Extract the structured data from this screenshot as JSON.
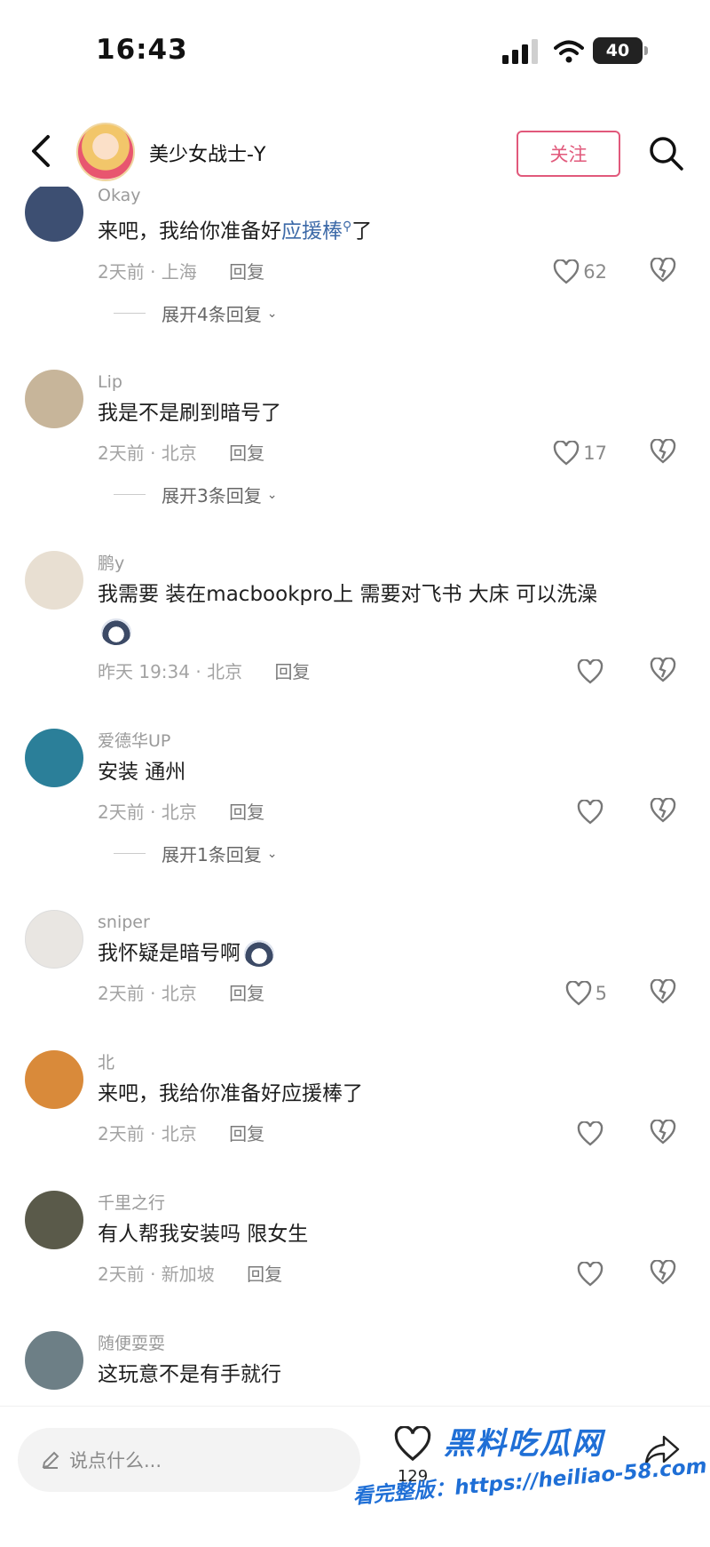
{
  "status": {
    "time": "16:43",
    "battery": "40"
  },
  "header": {
    "title": "美少女战士-Y",
    "follow_label": "关注"
  },
  "comments": [
    {
      "user": "Okay",
      "text_pre": "来吧，我给你准备好",
      "text_link": "应援棒",
      "text_post": "了",
      "time": "2天前 · 上海",
      "reply": "回复",
      "likes": "62",
      "expand": "展开4条回复",
      "avatar_color": "#3d4f72"
    },
    {
      "user": "Lip",
      "text": "我是不是刷到暗号了",
      "time": "2天前 · 北京",
      "reply": "回复",
      "likes": "17",
      "expand": "展开3条回复",
      "avatar_color": "#c7b59a"
    },
    {
      "user": "鹏y",
      "text": "我需要 装在macbookpro上 需要对飞书 大床 可以洗澡",
      "time": "昨天 19:34 · 北京",
      "reply": "回复",
      "likes": "",
      "avatar_color": "#e8dfd2"
    },
    {
      "user": "爱德华UP",
      "text": "安装 通州",
      "time": "2天前 · 北京",
      "reply": "回复",
      "likes": "",
      "expand": "展开1条回复",
      "avatar_color": "#2b7f99"
    },
    {
      "user": "sniper",
      "text": "我怀疑是暗号啊",
      "time": "2天前 · 北京",
      "reply": "回复",
      "likes": "5",
      "avatar_color": "#e9e6e2"
    },
    {
      "user": "北",
      "text": "来吧，我给你准备好应援棒了",
      "time": "2天前 · 北京",
      "reply": "回复",
      "likes": "",
      "avatar_color": "#d98a3a"
    },
    {
      "user": "千里之行",
      "text": "有人帮我安装吗 限女生",
      "time": "2天前 · 新加坡",
      "reply": "回复",
      "likes": "",
      "avatar_color": "#5a5a4a"
    },
    {
      "user": "随便耍耍",
      "text": "这玩意不是有手就行",
      "avatar_color": "#6d7f86"
    }
  ],
  "bottom": {
    "placeholder": "说点什么...",
    "heart_count": "129"
  },
  "watermark": {
    "logo": "黑料吃瓜网",
    "text": "看完整版：https://heiliao-58.com"
  }
}
